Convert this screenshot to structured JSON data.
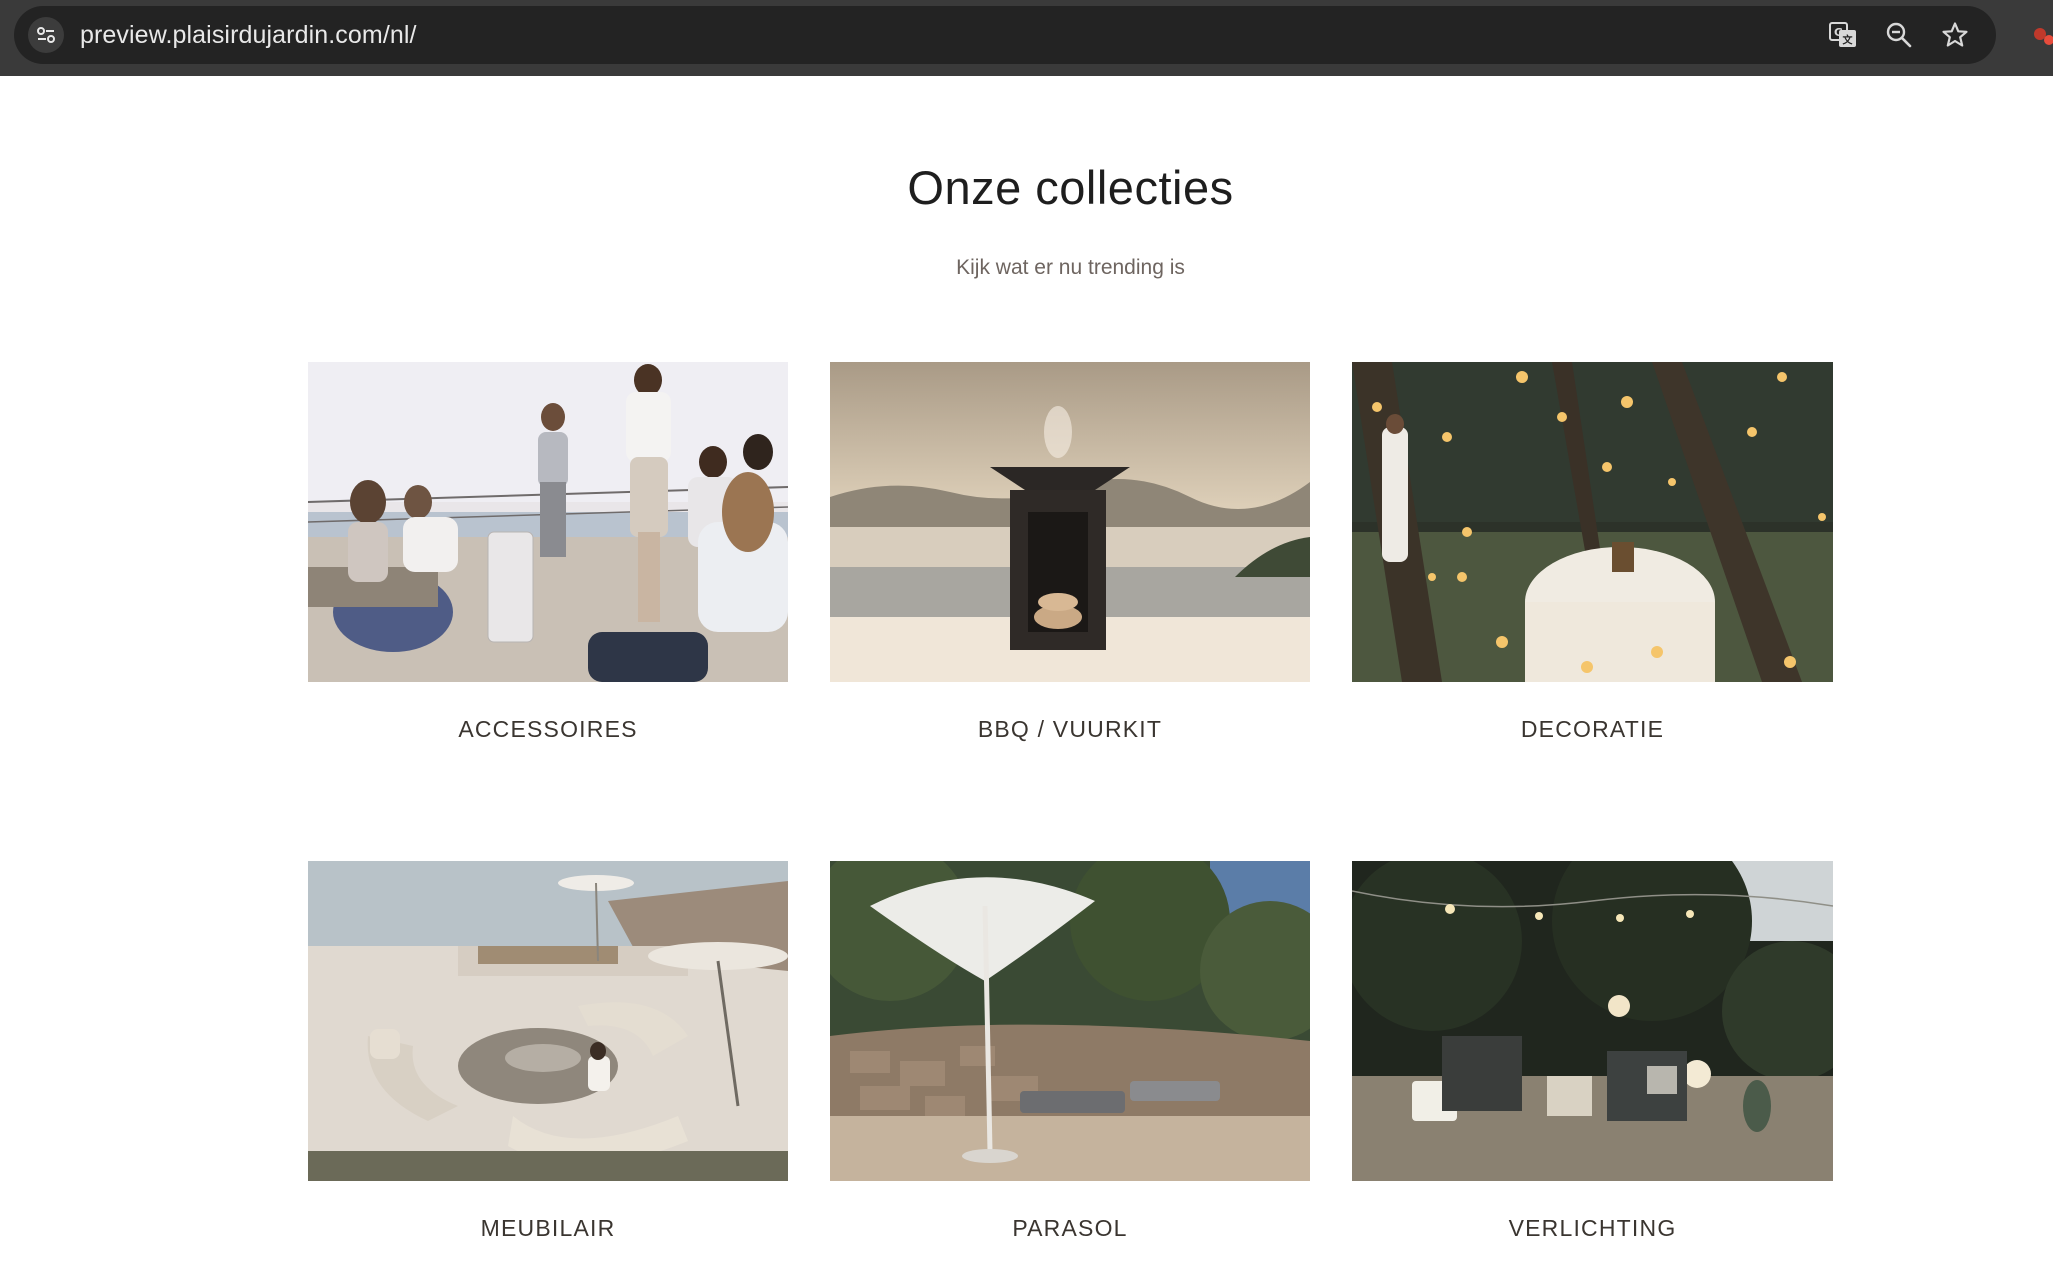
{
  "browser": {
    "url": "preview.plaisirdujardin.com/nl/",
    "icons": [
      "site-info-icon",
      "translate-icon",
      "zoom-out-icon",
      "bookmark-star-icon",
      "extension-icon"
    ]
  },
  "section": {
    "title": "Onze collecties",
    "subtitle": "Kijk wat er nu trending is"
  },
  "collections": [
    {
      "label": "ACCESSOIRES",
      "image": "people-on-terrace-photo"
    },
    {
      "label": "BBQ / VUURKIT",
      "image": "fire-pit-photo"
    },
    {
      "label": "DECORATIE",
      "image": "lanterns-dinner-photo"
    },
    {
      "label": "MEUBILAIR",
      "image": "lounge-furniture-photo"
    },
    {
      "label": "PARASOL",
      "image": "parasol-loungers-photo"
    },
    {
      "label": "VERLICHTING",
      "image": "garden-lighting-photo"
    }
  ]
}
